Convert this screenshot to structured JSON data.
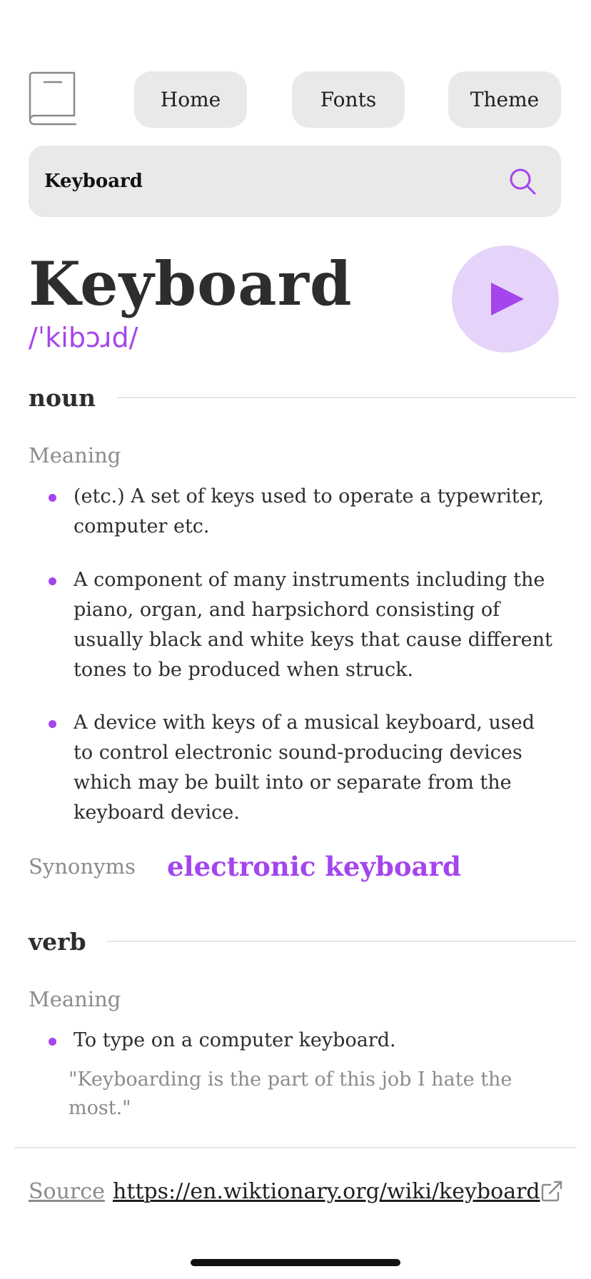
{
  "nav": {
    "home_label": "Home",
    "fonts_label": "Fonts",
    "theme_label": "Theme",
    "logo_icon": "book-icon"
  },
  "search": {
    "value": "Keyboard",
    "icon": "search-icon"
  },
  "entry": {
    "word": "Keyboard",
    "phonetic": "/ˈkibɔɹd/",
    "play_icon": "play-icon"
  },
  "meanings": {
    "noun": {
      "part_of_speech": "noun",
      "meaning_label": "Meaning",
      "definitions": [
        "(etc.) A set of keys used to operate a typewriter, computer etc.",
        "A component of many instruments including the piano, organ, and harpsichord consisting of usually black and white keys that cause different tones to be produced when struck.",
        "A device with keys of a musical keyboard, used to control electronic sound-producing devices which may be built into or separate from the keyboard device."
      ],
      "synonyms_label": "Synonyms",
      "synonyms": [
        "electronic keyboard"
      ]
    },
    "verb": {
      "part_of_speech": "verb",
      "meaning_label": "Meaning",
      "definitions": [
        "To type on a computer keyboard."
      ],
      "example": "\"Keyboarding is the part of this job I hate the most.\""
    }
  },
  "footer": {
    "source_label": "Source",
    "source_url": "https://en.wiktionary.org/wiki/keyboard",
    "external_icon": "external-link-icon"
  },
  "colors": {
    "accent": "#a445ed",
    "accent_light": "#e5d3f9",
    "surface": "#e9e9e9",
    "muted_text": "#8b8b8b",
    "text": "#2d2d2d"
  }
}
